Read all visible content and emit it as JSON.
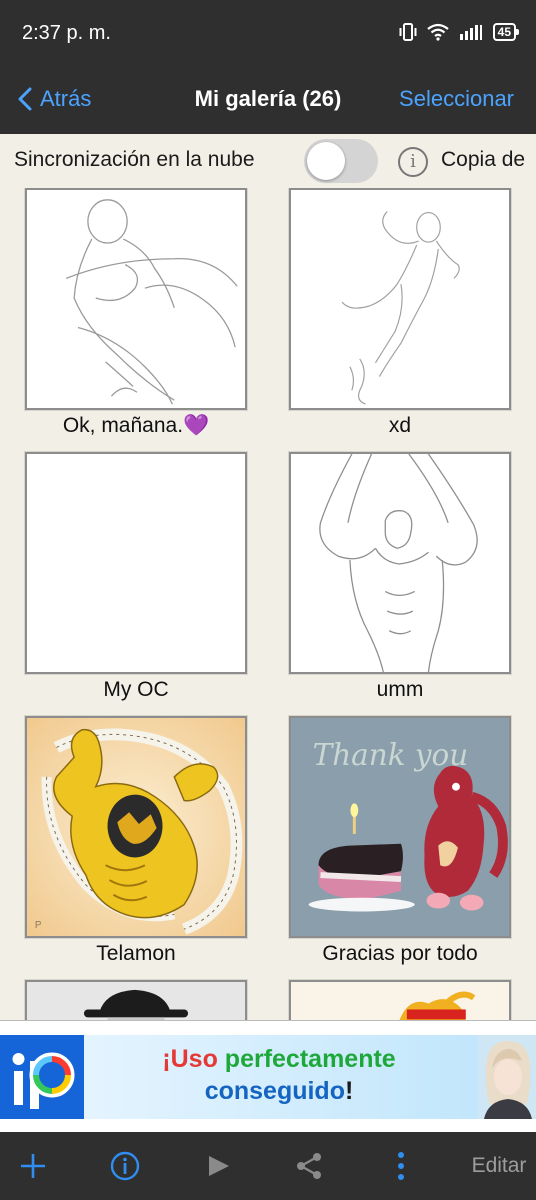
{
  "status_bar": {
    "time": "2:37 p. m.",
    "battery": "45",
    "icons": [
      "vibrate-icon",
      "wifi-icon",
      "signal-icon",
      "battery-icon"
    ]
  },
  "nav": {
    "back_label": "Atrás",
    "title": "Mi galería (26)",
    "select_label": "Seleccionar"
  },
  "sync": {
    "label": "Sincronización en la nube",
    "toggle_on": false,
    "backup_label": "Copia de"
  },
  "gallery": {
    "items": [
      {
        "caption": "Ok, mañana.💜",
        "kind": "sketch"
      },
      {
        "caption": "xd",
        "kind": "sketch"
      },
      {
        "caption": "My OC",
        "kind": "blank"
      },
      {
        "caption": "umm",
        "kind": "sketch"
      },
      {
        "caption": "Telamon",
        "kind": "painting"
      },
      {
        "caption": "Gracias por todo",
        "kind": "painting",
        "artwork_text": "Thank you"
      },
      {
        "caption": "",
        "kind": "partial"
      },
      {
        "caption": "",
        "kind": "partial"
      }
    ]
  },
  "ad": {
    "line1_start": "¡Uso ",
    "line1_highlight": "perfectamente",
    "line2_main": "conseguido",
    "line2_end": "!",
    "colors": {
      "red": "#e53935",
      "green": "#1fa83a",
      "blue": "#1565c0"
    }
  },
  "toolbar": {
    "items": [
      "add-icon",
      "info-icon",
      "play-icon",
      "share-icon",
      "more-icon"
    ],
    "edit_label": "Editar"
  },
  "colors": {
    "accent": "#4ba3ff",
    "bar": "#2f2f2f",
    "background": "#f2f0e6"
  }
}
